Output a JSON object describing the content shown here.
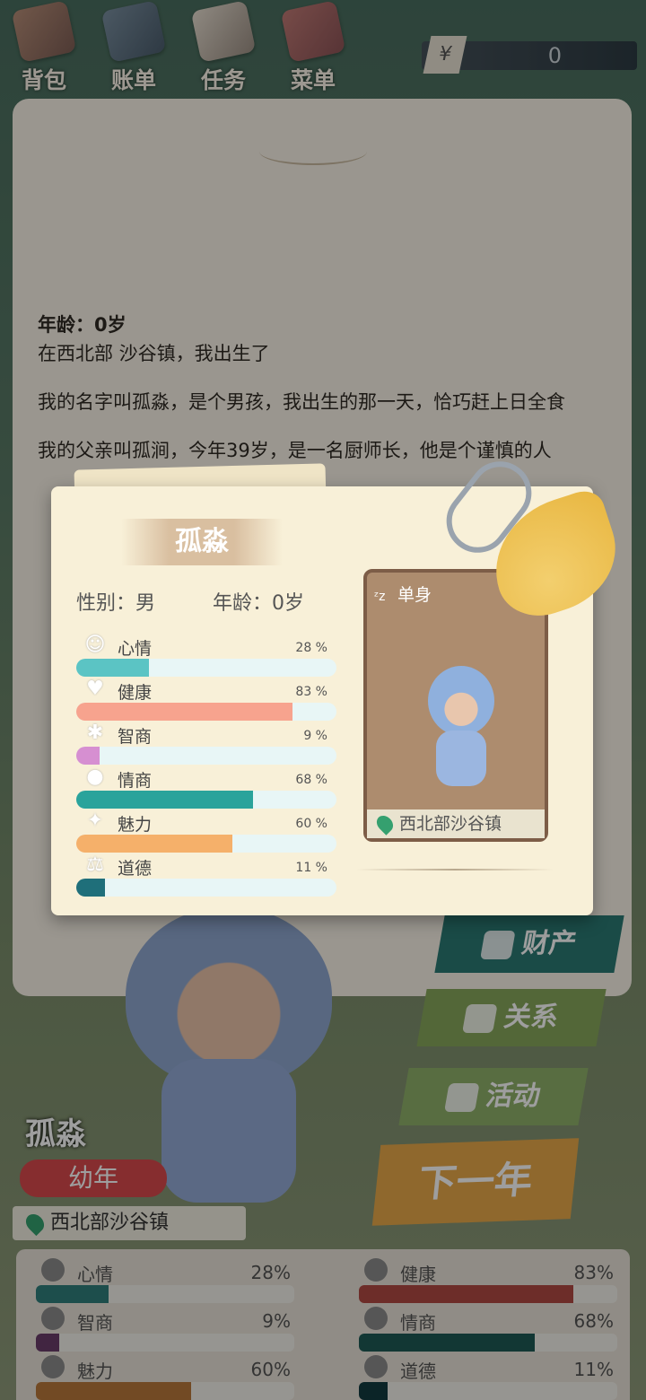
{
  "toolbar": {
    "items": [
      {
        "label": "背包",
        "icon": "backpack-icon"
      },
      {
        "label": "账单",
        "icon": "bill-icon"
      },
      {
        "label": "任务",
        "icon": "task-icon"
      },
      {
        "label": "菜单",
        "icon": "menu-book-icon"
      }
    ],
    "money": {
      "symbol": "¥",
      "amount": "0"
    }
  },
  "story": {
    "age_line": "年龄：0岁",
    "paragraphs": [
      "在西北部 沙谷镇，我出生了",
      "我的名字叫孤淼，是个男孩，我出生的那一天，恰巧赶上日全食",
      "我的父亲叫孤涧，今年39岁，是一名厨师长，他是个谨慎的人"
    ]
  },
  "character": {
    "name": "孤淼",
    "stage": "幼年",
    "location": "西北部沙谷镇"
  },
  "side_menu": {
    "property": "财产",
    "relations": "关系",
    "activity": "活动",
    "next_year": "下一年"
  },
  "bottom_stats": [
    {
      "name": "心情",
      "value": "28%",
      "level": 0.28,
      "color": "#2f7f7b"
    },
    {
      "name": "健康",
      "value": "83%",
      "level": 0.83,
      "color": "#b14a43"
    },
    {
      "name": "智商",
      "value": "9%",
      "level": 0.09,
      "color": "#6a3c6a"
    },
    {
      "name": "情商",
      "value": "68%",
      "level": 0.68,
      "color": "#1e5a55"
    },
    {
      "name": "魅力",
      "value": "60%",
      "level": 0.6,
      "color": "#b8783a"
    },
    {
      "name": "道德",
      "value": "11%",
      "level": 0.11,
      "color": "#123a40"
    }
  ],
  "popup": {
    "name": "孤淼",
    "gender": "性别：男",
    "age": "年龄：0岁",
    "relationship_status": "单身",
    "location": "西北部沙谷镇",
    "stats": [
      {
        "name": "心情",
        "value": "28 %",
        "level": 0.28,
        "color": "#5bc4c4",
        "icon": "smile-icon"
      },
      {
        "name": "健康",
        "value": "83 %",
        "level": 0.83,
        "color": "#f7a38e",
        "icon": "heart-icon"
      },
      {
        "name": "智商",
        "value": "9 %",
        "level": 0.09,
        "color": "#d68fd1",
        "icon": "lightbulb-icon"
      },
      {
        "name": "情商",
        "value": "68 %",
        "level": 0.68,
        "color": "#2aa39b",
        "icon": "apple-icon"
      },
      {
        "name": "魅力",
        "value": "60 %",
        "level": 0.6,
        "color": "#f5b06a",
        "icon": "sparkle-icon"
      },
      {
        "name": "道德",
        "value": "11 %",
        "level": 0.11,
        "color": "#1f6f7a",
        "icon": "scales-icon"
      }
    ]
  }
}
